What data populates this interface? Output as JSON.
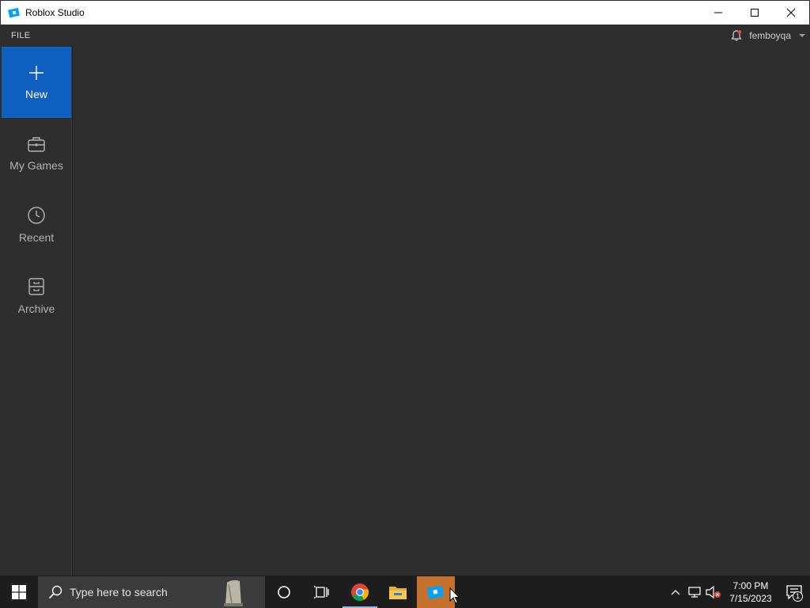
{
  "window": {
    "title": "Roblox Studio",
    "controls": {
      "minimize": "minimize-icon",
      "maximize": "maximize-icon",
      "close": "close-icon"
    }
  },
  "menubar": {
    "file_label": "FILE",
    "username": "femboyqa",
    "notification_icon": "bell-icon"
  },
  "sidebar": {
    "items": [
      {
        "label": "New",
        "icon": "plus-icon",
        "active": true
      },
      {
        "label": "My Games",
        "icon": "briefcase-icon",
        "active": false
      },
      {
        "label": "Recent",
        "icon": "clock-icon",
        "active": false
      },
      {
        "label": "Archive",
        "icon": "archive-icon",
        "active": false
      }
    ]
  },
  "taskbar": {
    "search_placeholder": "Type here to search",
    "apps": [
      "cortana-icon",
      "task-view-icon",
      "chrome-icon",
      "file-explorer-icon",
      "roblox-studio-icon"
    ],
    "clock": {
      "time": "7:00 PM",
      "date": "7/15/2023"
    },
    "notification_count": "1"
  },
  "colors": {
    "accent": "#0f5fc0",
    "sidebar_bg": "#2e2e2e",
    "main_bg": "#2e2e2e",
    "taskbar_bg": "#1d1d1d",
    "active_task": "#c5712e"
  }
}
